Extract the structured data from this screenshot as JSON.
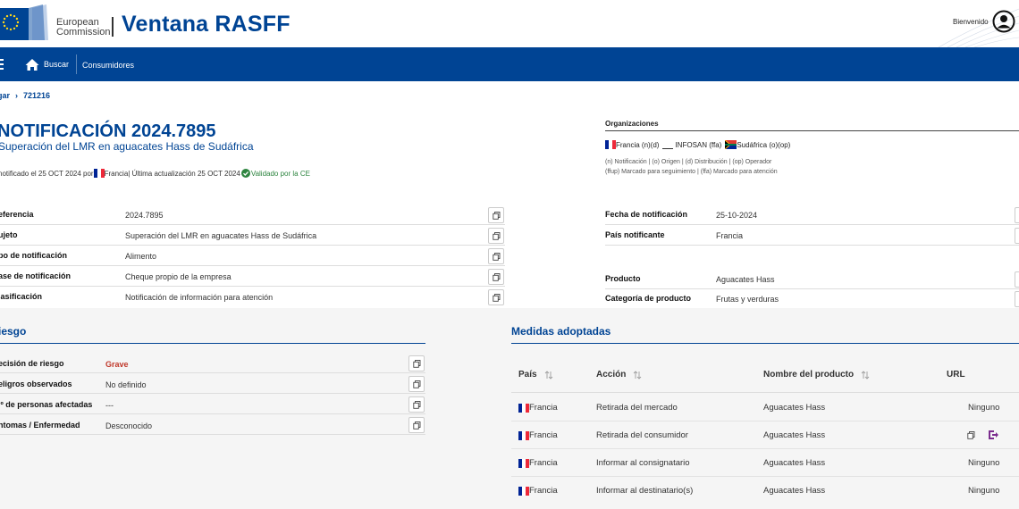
{
  "header": {
    "ec_line1": "European",
    "ec_line2": "Commission",
    "app_title": "Ventana RASFF",
    "welcome": "Bienvenido"
  },
  "nav": {
    "home_label": "Buscar",
    "consumers_label": "Consumidores"
  },
  "breadcrumb": {
    "parent": "gar",
    "current": "721216"
  },
  "notification": {
    "title": "NOTIFICACIÓN 2024.7895",
    "subtitle": "Superación del LMR en aguacates Hass de Sudáfrica",
    "meta_notified": "notificado el 25 OCT 2024 por",
    "meta_country": "Francia",
    "meta_updated": " | Última actualización 25 OCT 2024",
    "validated": "Validado por la CE"
  },
  "organizations": {
    "title": "Organizaciones",
    "france": "Francia (n)(d)",
    "infosan": "INFOSAN (ffa)",
    "south_africa": "Sudáfrica (o)(op)",
    "legend_line1": "(n) Notificación | (o) Origen | (d) Distribución | (op) Operador",
    "legend_line2": "(ffup) Marcado para seguimiento | (ffa) Marcado para atención"
  },
  "details_left": [
    {
      "label": "eferencia",
      "value": "2024.7895"
    },
    {
      "label": "ujeto",
      "value": "Superación del LMR en aguacates Hass de Sudáfrica"
    },
    {
      "label": "po de notificación",
      "value": "Alimento"
    },
    {
      "label": "ase de notificación",
      "value": "Cheque propio de la empresa"
    },
    {
      "label": "lasificación",
      "value": "Notificación de información para atención"
    }
  ],
  "details_right": [
    {
      "label": "Fecha de notificación",
      "value": "25-10-2024"
    },
    {
      "label": "País notificante",
      "value": "Francia"
    },
    {
      "label": "Producto",
      "value": "Aguacates Hass"
    },
    {
      "label": "Categoría de producto",
      "value": "Frutas y verduras"
    }
  ],
  "risk": {
    "title": "iesgo",
    "rows": [
      {
        "label": "ecisión de riesgo",
        "value": "Grave"
      },
      {
        "label": "eligros observados",
        "value": "No definido"
      },
      {
        "label": ".º de personas afectadas",
        "value": "---"
      },
      {
        "label": "ntomas / Enfermedad",
        "value": "Desconocido"
      }
    ]
  },
  "measures": {
    "title": "Medidas adoptadas",
    "headers": {
      "country": "País",
      "action": "Acción",
      "product": "Nombre del producto",
      "url": "URL"
    },
    "rows": [
      {
        "country": "Francia",
        "action": "Retirada del mercado",
        "product": "Aguacates Hass",
        "url": "Ninguno"
      },
      {
        "country": "Francia",
        "action": "Retirada del consumidor",
        "product": "Aguacates Hass",
        "url": ""
      },
      {
        "country": "Francia",
        "action": "Informar al consignatario",
        "product": "Aguacates Hass",
        "url": "Ninguno"
      },
      {
        "country": "Francia",
        "action": "Informar al destinatario(s)",
        "product": "Aguacates Hass",
        "url": "Ninguno"
      }
    ]
  },
  "colors": {
    "brand_blue": "#004494",
    "grave_red": "#c0392b",
    "validated_green": "#2e8540"
  }
}
